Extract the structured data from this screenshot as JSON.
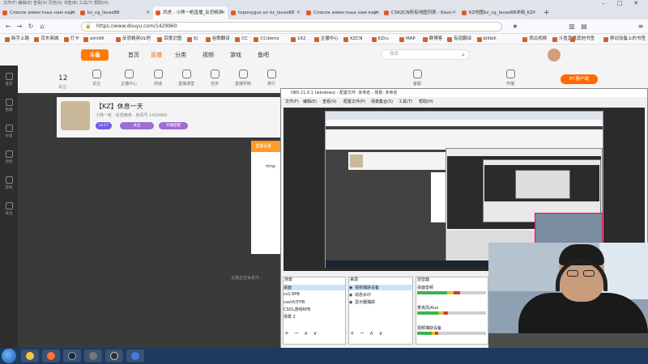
{
  "browser": {
    "window_title": "文件(F)  编辑(E)  查看(V)  历史(S)  书签(B)  工具(T)  帮助(H)",
    "tabs": [
      {
        "label": "Список известных нам карт"
      },
      {
        "label": "kz_cg_lavas88"
      },
      {
        "label": "风虎 - 小熊一枪直播_反恐精英"
      },
      {
        "label": "topovygus on kz_lavas88"
      },
      {
        "label": "Список известных нам карт"
      },
      {
        "label": "CSKZCN所有地图列表 - Kavo"
      },
      {
        "label": "KZ地图kz_cg_lavas88详细_KZ"
      }
    ],
    "url": "https://www.douyu.com/1429960",
    "bookmarks": [
      "新手上路",
      "京东商城",
      "打卡",
      "aim99",
      "反恐精英OL吧",
      "百度识图",
      "XJ",
      "谷歌翻译",
      "CC",
      "CCdemo",
      "162",
      "主播中心",
      "KZCN",
      "KZru",
      "MAP",
      "群博客",
      "有道翻译",
      "bilibili",
      "西瓜视频",
      "斗鱼直播"
    ],
    "bookmarks_right": [
      "其他书签",
      "移动设备上的书签"
    ]
  },
  "douyu": {
    "logo": "斗鱼",
    "menu": [
      "首页",
      "直播",
      "分类",
      "视频",
      "游戏",
      "鱼吧"
    ],
    "menu_active_index": 1,
    "search_placeholder": "搜索",
    "categories": [
      "关注",
      "主播中心",
      "商城",
      "直播课堂",
      "任务",
      "直播学院",
      "排行",
      "客服",
      "开播"
    ],
    "sidebar": [
      "推荐",
      "直播",
      "分类",
      "视频",
      "游戏",
      "关注"
    ],
    "sidebar_count": "12",
    "sidebar_count_label": "关注",
    "pc_client_button": "PC客户端",
    "room_title": "【KZ】休息一天",
    "room_meta": "小熊一枪 · 反恐精英 · 房间号 1429960",
    "tags": [
      "LV.17",
      "关注",
      "开播提醒"
    ],
    "popup_header": "直播设置",
    "popup_text": "rtmp",
    "bottom_hint": "主播正在休息中..."
  },
  "obs": {
    "title": "OBS 21.0.1 (windows) - 配置文件: 未命名 - 场景: 未命名",
    "menu": [
      "文件(F)",
      "编辑(E)",
      "查看(V)",
      "配置文件(P)",
      "场景集合(S)",
      "工具(T)",
      "帮助(H)"
    ],
    "scenes_title": "场景",
    "scenes": [
      "桌面",
      "cs1.6PB",
      "csol大厅PB",
      "CSOL游戏RPB",
      "场景 2"
    ],
    "sources_title": "来源",
    "sources": [
      "视频捕获设备",
      "动态水印",
      "显示器捕获"
    ],
    "mixer_title": "混音器",
    "mixer": [
      {
        "label": "桌面音频",
        "level": 0.62
      },
      {
        "label": "麦克风/Aux",
        "level": 0.45
      },
      {
        "label": "视频捕获设备",
        "level": 0.3
      }
    ],
    "dock_tools": "+ − ∧ ∨"
  },
  "colors": {
    "douyu_orange": "#ff6a00",
    "taskbar": "#1e3a5f",
    "obs_bg": "#2b2b2b"
  }
}
